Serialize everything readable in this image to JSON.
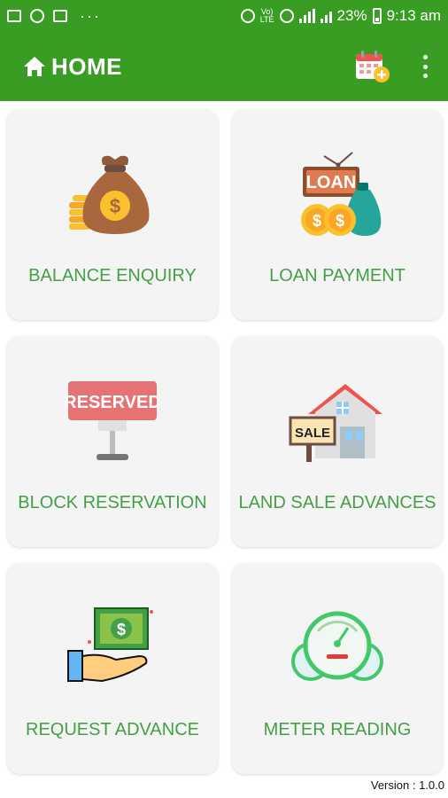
{
  "status_bar": {
    "battery": "23%",
    "time": "9:13 am",
    "network_small_top": "Vo)",
    "network_small_bottom": "LTE"
  },
  "app_bar": {
    "title": "HOME",
    "color": "#3a9d23"
  },
  "tiles": [
    {
      "label": "BALANCE ENQUIRY",
      "icon": "money-bag-icon"
    },
    {
      "label": "LOAN PAYMENT",
      "icon": "loan-sign-icon"
    },
    {
      "label": "BLOCK RESERVATION",
      "icon": "reserved-sign-icon"
    },
    {
      "label": "LAND SALE ADVANCES",
      "icon": "house-sale-icon"
    },
    {
      "label": "REQUEST ADVANCE",
      "icon": "hand-cash-icon"
    },
    {
      "label": "METER READING",
      "icon": "meter-gauge-icon"
    }
  ],
  "footer": {
    "version": "Version : 1.0.0"
  },
  "colors": {
    "accent": "#3a9d23",
    "label": "#43a047",
    "card_bg": "#f4f4f4"
  }
}
